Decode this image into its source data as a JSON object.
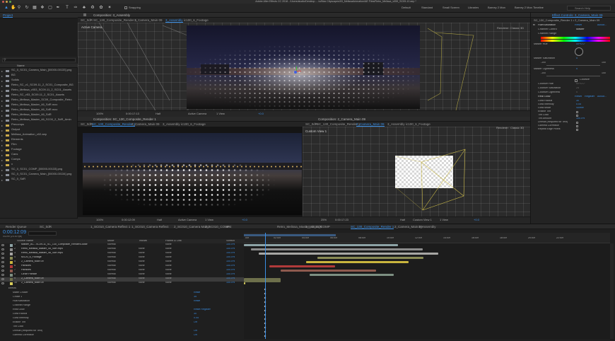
{
  "titlebar": {
    "title": "Adobe After Effects CC 2018 - /Users/studio/Desktop ... to/Max Cityscapes/03_MelissaAnimation/AE Files/Retro_Melissa_v059_SC09-12.aep *"
  },
  "toolbar": {
    "snapping_label": "Snapping",
    "workspaces": [
      "Default",
      "Standard",
      "Small Screen",
      "Libraries",
      "Barney 2 Mon",
      "Barney 2 Mon Timeline"
    ],
    "search_placeholder": "Search Help"
  },
  "project": {
    "tab_label": "Project",
    "column_name": "Name",
    "items": [
      "SC_0_SC01_Camera_Main_[00000-00133].png",
      "BG",
      "Solids",
      "Retro_SC_v1_SC09-11_2_SC01_Composite_BG",
      "Retro_Melissa_v053_SC09-11_2_SC01_Assets",
      "Retro_SC_v53_SC09-11_2_SC01_Assets",
      "Retro_Melissa_Master_SC09_Composite_Retro",
      "Retro_Melissa_Master_46_SdR.mov",
      "Retro_Melissa_Master_46_SdR.mov",
      "Retro_Melissa_Master_46_SdR",
      "Retro_Melissa_Master_46_SC00_2_SdR_Amin",
      "Precomps",
      "Output",
      "Melissa_Animation_v02.aep",
      "Elements",
      "Film",
      "Footage",
      "Cans",
      "Comps",
      "x",
      "SC_0_SC01_COMP_[00000-00133].png",
      "SC_0_SC01_Camera_Main_[00000-00134].png",
      "SC_0_SdR"
    ]
  },
  "top_viewer": {
    "header": "Composition: 3_Assembly",
    "tabs": [
      "SC_0dR",
      "SC_130_Composite_Render 1",
      "2_Camera_Main 09",
      "3_Assembly",
      "ic100_6_Footage"
    ],
    "active_tab": 3,
    "label": "Active Camera",
    "renderer_label": "Renderer:",
    "renderer_value": "Classic 3D",
    "zoom": "100%",
    "timecode": "0:00:17:13",
    "resolution": "Half",
    "view": "Active Camera",
    "views": "1 View",
    "exposure": "+0.0"
  },
  "left_viewer": {
    "header": "Composition: SC_130_Composite_Render 1",
    "tabs": [
      "SC_0dR",
      "SC_130_Composite_Render 1",
      "2_Camera_Main 09",
      "3_Assembly",
      "ic100_6_Footage"
    ],
    "active_tab": 1,
    "zoom": "100%",
    "timecode": "0:00:12:09",
    "resolution": "Half",
    "view": "Active Camera",
    "views": "1 View",
    "exposure": "+0.0"
  },
  "right_viewer": {
    "header": "Composition: 2_Camera_Main 09",
    "tabs": [
      "SC_0dR",
      "SC_130_Composite_Render 1",
      "2_Camera_Main 09",
      "3_Assembly",
      "ic100_6_Footage"
    ],
    "active_tab": 2,
    "label": "Custom View 1",
    "renderer_label": "Renderer:",
    "renderer_value": "Classic 3D",
    "zoom": "25%",
    "timecode": "0:00:17:23",
    "resolution": "Half",
    "view": "Custom View 1",
    "views": "1 View",
    "exposure": "+0.0"
  },
  "effects": {
    "header": "Effect Controls: 3_Camera_Main 09",
    "layer": "SC_130_Composite_Render 1 • 2_Camera_Main 09",
    "hue": {
      "name": "Hue/Saturation",
      "reset": "Reset",
      "about": "About...",
      "channel_control": "Channel Control",
      "channel_value": "Master",
      "channel_range": "Channel Range",
      "master_hue": "Master Hue",
      "master_hue_value": "0x+0.0°",
      "master_saturation": "Master Saturation",
      "master_saturation_value": "0",
      "sat_min": "-100",
      "sat_max": "100",
      "master_lightness": "Master Lightness",
      "master_lightness_value": "0",
      "light_min": "-100",
      "light_max": "100",
      "colorize": "Colorize",
      "colorize_hue": "Colorize Hue",
      "colorize_hue_value": "0x+0.0°",
      "colorize_saturation": "Colorize Saturation",
      "colorize_saturation_value": "25",
      "colorize_lightness": "Colorize Lightness",
      "colorize_lightness_value": "0"
    },
    "glow": {
      "name": "Real Glow",
      "reset": "Reset",
      "register": "Register",
      "about": "About...",
      "props": [
        {
          "label": "Glow Radius",
          "value": "30"
        },
        {
          "label": "Glow Intensity",
          "value": "0.05"
        },
        {
          "label": "Glow Mode",
          "value": "Screen"
        },
        {
          "label": "Enable Tint",
          "value": ""
        },
        {
          "label": "Tint Color",
          "value": ""
        },
        {
          "label": "Tint Amount",
          "value": "100.0%"
        },
        {
          "label": "Unmult (Required for Text)",
          "value": ""
        },
        {
          "label": "Gamma Correction",
          "value": ""
        },
        {
          "label": "Repeat Edge Pixels",
          "value": ""
        }
      ]
    }
  },
  "timeline": {
    "tabs": [
      "Render Queue",
      "SC_0dR",
      "1_SC010_Camera Reflect 1",
      "1_SC010_Camera Reflect",
      "2_SC010_Camera Main2",
      "2_SC010_COMP",
      "test",
      "Retro_Melissa_Master_46_SdR",
      "1_SC010_COMP",
      "SC_130_Composite_Render 1",
      "2_Camera_Main 09",
      "3_Assembly"
    ],
    "active_tab": 9,
    "timecode": "0:00:12:09",
    "frame_info": "00299 (24.00 fps)",
    "col_source": "Source Name",
    "col_mode": "Mode",
    "col_trkmat": "TrkMat",
    "col_parent": "Parent & Link",
    "col_stretch": "Stretch",
    "layers": [
      {
        "num": "1",
        "name": "Master_AC...SC09-11_SC_130_Composite_Render/Loose",
        "mode": "Normal",
        "trk": "",
        "parent": "None",
        "stretch": "100.0%"
      },
      {
        "num": "2",
        "name": "Retro_Melissa_Master_45_SdR.mp4",
        "mode": "Normal",
        "trk": "None",
        "parent": "None",
        "stretch": "100.0%"
      },
      {
        "num": "3",
        "name": "Retro_Melissa_Master_46_SdR.mp4",
        "mode": "Normal",
        "trk": "None",
        "parent": "None",
        "stretch": "100.0%"
      },
      {
        "num": "4",
        "name": "sc120_6_Footage",
        "mode": "Normal",
        "trk": "None",
        "parent": "None",
        "stretch": "100.0%"
      },
      {
        "num": "5",
        "name": "2_Camera_Main 09",
        "mode": "Normal",
        "trk": "None",
        "parent": "None",
        "stretch": "100.0%"
      },
      {
        "num": "6",
        "name": "Particles",
        "mode": "Normal",
        "trk": "None",
        "parent": "None",
        "stretch": "100.0%"
      },
      {
        "num": "7",
        "name": "Particles",
        "mode": "Normal",
        "trk": "None",
        "parent": "None",
        "stretch": "100.0%"
      },
      {
        "num": "8",
        "name": "Circle Particle",
        "mode": "Normal",
        "trk": "None",
        "parent": "None",
        "stretch": "100.0%"
      },
      {
        "num": "9",
        "name": "2_Camera_Main 09",
        "mode": "Normal",
        "trk": "None",
        "parent": "None",
        "stretch": "100.0%"
      },
      {
        "num": "10",
        "name": "2_Camera_Main 09",
        "mode": "Normal",
        "trk": "None",
        "parent": "None",
        "stretch": "100.0%"
      }
    ],
    "props": [
      {
        "label": "Effects",
        "value": ""
      },
      {
        "label": "Matte Choker",
        "value": "Reset"
      },
      {
        "label": "Choke 1",
        "value": "35"
      },
      {
        "label": "Hue/Saturation",
        "value": "Reset"
      },
      {
        "label": "Channel Range",
        "value": ""
      },
      {
        "label": "Real Glow",
        "value": "Reset  Register"
      },
      {
        "label": "Glow Radius",
        "value": "30"
      },
      {
        "label": "Glow Intensity",
        "value": "0.05"
      },
      {
        "label": "Enable Tint",
        "value": "Off"
      },
      {
        "label": "Tint Color",
        "value": ""
      },
      {
        "label": "Unmult (Required for Text)",
        "value": "Off"
      },
      {
        "label": "Gamma Correction",
        "value": "On"
      }
    ],
    "ruler": [
      "00f",
      "02:00f",
      "04:00f",
      "06:00f",
      "08:00f",
      "10:00f",
      "12:00f",
      "14:00f",
      "16:00f",
      "18:00f",
      "20:00f",
      "22:00f"
    ],
    "bar_colors": [
      "#8da3a6",
      "#8b8b8b",
      "#a7a6a4",
      "#8a8b55",
      "#c9b53e",
      "#b13a3a",
      "#8e5a4e",
      "#7d8f82",
      "#6d6f4b",
      "#d9cd5b"
    ]
  }
}
